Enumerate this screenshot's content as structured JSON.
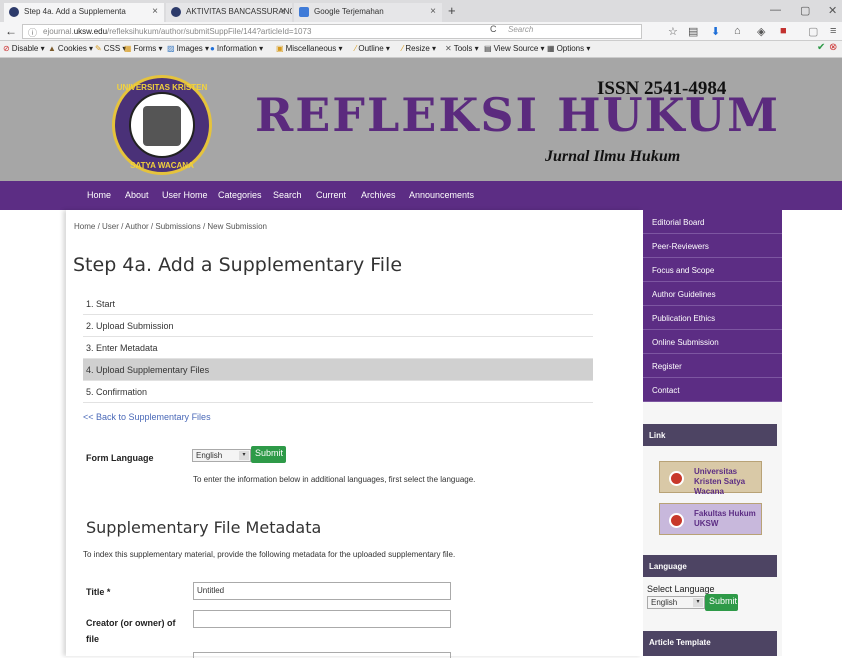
{
  "browser": {
    "tabs": [
      {
        "label": "Step 4a. Add a Supplementa",
        "close": "×"
      },
      {
        "label": "AKTIVITAS BANCASSURANC",
        "close": "×"
      },
      {
        "label": "Google Terjemahan",
        "close": "×"
      }
    ],
    "new_tab": "+",
    "url_prefix": "ejournal.",
    "url_domain": "uksw.edu",
    "url_path": "/refleksihukum/author/submitSuppFile/144?articleId=1073",
    "search_placeholder": "Search",
    "reload": "C",
    "back": "←",
    "info": "ⓘ",
    "minimize": "—",
    "maximize": "▢",
    "close": "✕"
  },
  "devtoolbar": [
    "Disable",
    "Cookies",
    "CSS",
    "Forms",
    "Images",
    "Information",
    "Miscellaneous",
    "Outline",
    "Resize",
    "Tools",
    "View Source",
    "Options"
  ],
  "site": {
    "issn": "ISSN 2541-4984",
    "title": "REFLEKSI HUKUM",
    "subtitle": "Jurnal Ilmu Hukum",
    "logo_top": "UNIVERSITAS KRISTEN",
    "logo_bottom": "SATYA WACANA"
  },
  "menu": [
    "Home",
    "About",
    "User Home",
    "Categories",
    "Search",
    "Current",
    "Archives",
    "Announcements"
  ],
  "breadcrumb": "Home / User / Author / Submissions / New Submission",
  "page_title": "Step 4a. Add a Supplementary File",
  "steps": [
    "1. Start",
    "2. Upload Submission",
    "3. Enter Metadata",
    "4. Upload Supplementary Files",
    "5. Confirmation"
  ],
  "back_link": "<< Back to Supplementary Files",
  "form_language": {
    "label": "Form Language",
    "selected": "English",
    "submit": "Submit",
    "help": "To enter the information below in additional languages, first select the language."
  },
  "metadata": {
    "heading": "Supplementary File Metadata",
    "description": "To index this supplementary material, provide the following metadata for the uploaded supplementary file.",
    "title_label": "Title *",
    "title_value": "Untitled",
    "creator_label": "Creator (or owner) of file"
  },
  "sidebar": {
    "links": [
      "Editorial Board",
      "Peer-Reviewers",
      "Focus and Scope",
      "Author Guidelines",
      "Publication Ethics",
      "Online Submission",
      "Register",
      "Contact"
    ],
    "link_heading": "Link",
    "banner1": "Universitas Kristen Satya Wacana",
    "banner2": "Fakultas Hukum UKSW",
    "language_heading": "Language",
    "language_label": "Select Language",
    "language_selected": "English",
    "language_submit": "Submit",
    "template_heading": "Article Template"
  }
}
